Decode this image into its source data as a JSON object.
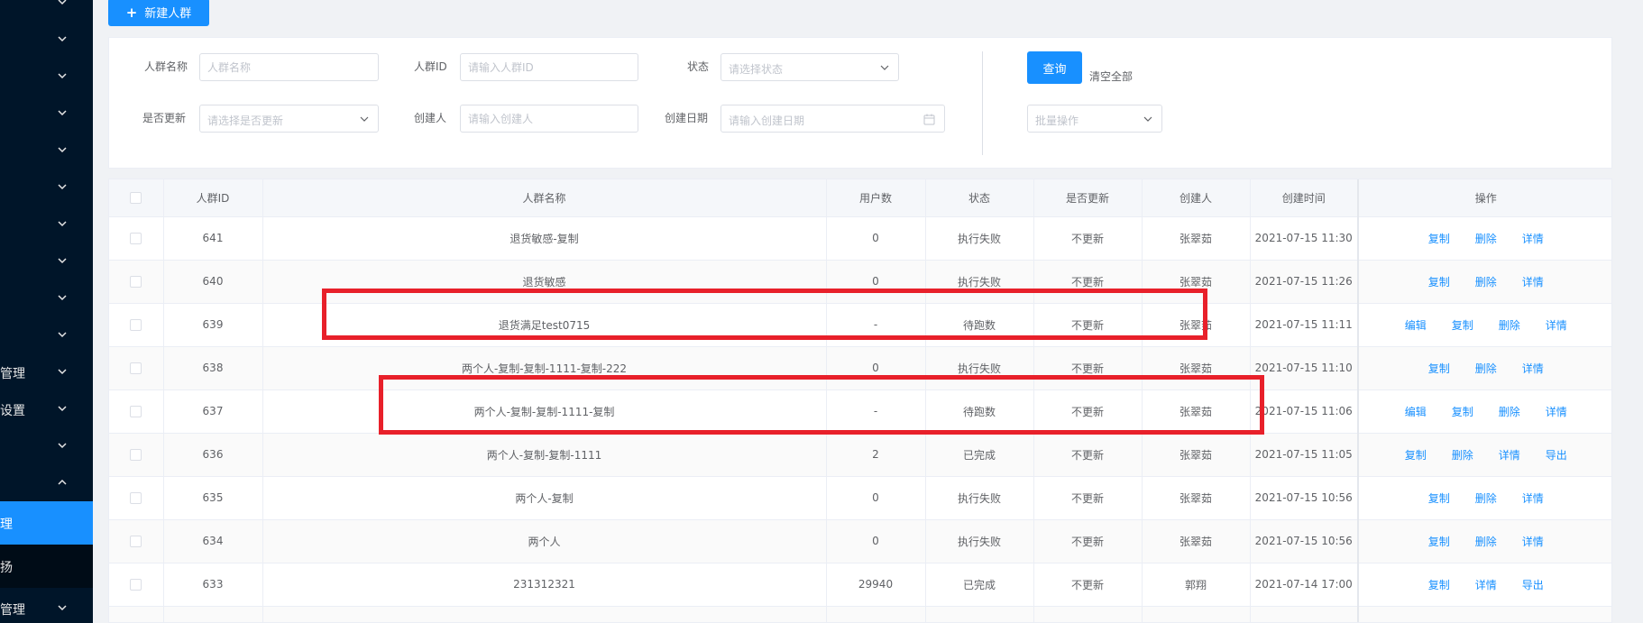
{
  "sidebar": {
    "items": [
      {
        "label": ""
      },
      {
        "label": ""
      },
      {
        "label": ""
      },
      {
        "label": ""
      },
      {
        "label": ""
      },
      {
        "label": ""
      },
      {
        "label": ""
      },
      {
        "label": ""
      },
      {
        "label": ""
      },
      {
        "label": ""
      },
      {
        "label": "管理"
      },
      {
        "label": "设置"
      },
      {
        "label": ""
      },
      {
        "label": ""
      }
    ],
    "active_item": {
      "label": "理"
    },
    "sub_item": {
      "label": "扬"
    },
    "last_item": {
      "label": "管理"
    }
  },
  "toolbar": {
    "new_label": "新建人群"
  },
  "filters": {
    "name_label": "人群名称",
    "name_placeholder": "人群名称",
    "id_label": "人群ID",
    "id_placeholder": "请输入人群ID",
    "status_label": "状态",
    "status_placeholder": "请选择状态",
    "update_label": "是否更新",
    "update_placeholder": "请选择是否更新",
    "creator_label": "创建人",
    "creator_placeholder": "请输入创建人",
    "date_label": "创建日期",
    "date_placeholder": "请输入创建日期",
    "query_label": "查询",
    "clear_label": "清空全部",
    "batch_placeholder": "批量操作"
  },
  "table": {
    "headers": {
      "id": "人群ID",
      "name": "人群名称",
      "users": "用户数",
      "status": "状态",
      "update": "是否更新",
      "creator": "创建人",
      "created": "创建时间",
      "ops": "操作"
    },
    "rows": [
      {
        "id": "641",
        "name": "退货敏感-复制",
        "users": "0",
        "status": "执行失败",
        "update": "不更新",
        "creator": "张翠茹",
        "created": "2021-07-15 11:30",
        "actions": [
          "复制",
          "删除",
          "详情"
        ]
      },
      {
        "id": "640",
        "name": "退货敏感",
        "users": "0",
        "status": "执行失败",
        "update": "不更新",
        "creator": "张翠茹",
        "created": "2021-07-15 11:26",
        "actions": [
          "复制",
          "删除",
          "详情"
        ]
      },
      {
        "id": "639",
        "name": "退货满足test0715",
        "users": "-",
        "status": "待跑数",
        "update": "不更新",
        "creator": "张翠茹",
        "created": "2021-07-15 11:11",
        "actions": [
          "编辑",
          "复制",
          "删除",
          "详情"
        ]
      },
      {
        "id": "638",
        "name": "两个人-复制-复制-1111-复制-222",
        "users": "0",
        "status": "执行失败",
        "update": "不更新",
        "creator": "张翠茹",
        "created": "2021-07-15 11:10",
        "actions": [
          "复制",
          "删除",
          "详情"
        ]
      },
      {
        "id": "637",
        "name": "两个人-复制-复制-1111-复制",
        "users": "-",
        "status": "待跑数",
        "update": "不更新",
        "creator": "张翠茹",
        "created": "2021-07-15 11:06",
        "actions": [
          "编辑",
          "复制",
          "删除",
          "详情"
        ]
      },
      {
        "id": "636",
        "name": "两个人-复制-复制-1111",
        "users": "2",
        "status": "已完成",
        "update": "不更新",
        "creator": "张翠茹",
        "created": "2021-07-15 11:05",
        "actions": [
          "复制",
          "删除",
          "详情",
          "导出"
        ]
      },
      {
        "id": "635",
        "name": "两个人-复制",
        "users": "0",
        "status": "执行失败",
        "update": "不更新",
        "creator": "张翠茹",
        "created": "2021-07-15 10:56",
        "actions": [
          "复制",
          "删除",
          "详情"
        ]
      },
      {
        "id": "634",
        "name": "两个人",
        "users": "0",
        "status": "执行失败",
        "update": "不更新",
        "creator": "张翠茹",
        "created": "2021-07-15 10:56",
        "actions": [
          "复制",
          "删除",
          "详情"
        ]
      },
      {
        "id": "633",
        "name": "231312321",
        "users": "29940",
        "status": "已完成",
        "update": "不更新",
        "creator": "郭翔",
        "created": "2021-07-14 17:00",
        "actions": [
          "复制",
          "详情",
          "导出"
        ]
      },
      {
        "id": "",
        "name": "",
        "users": "",
        "status": "",
        "update": "",
        "creator": "",
        "created": "",
        "actions": []
      }
    ]
  },
  "colors": {
    "primary": "#1890ff",
    "sidebar_bg": "#001529",
    "highlight": "#e8202a"
  }
}
